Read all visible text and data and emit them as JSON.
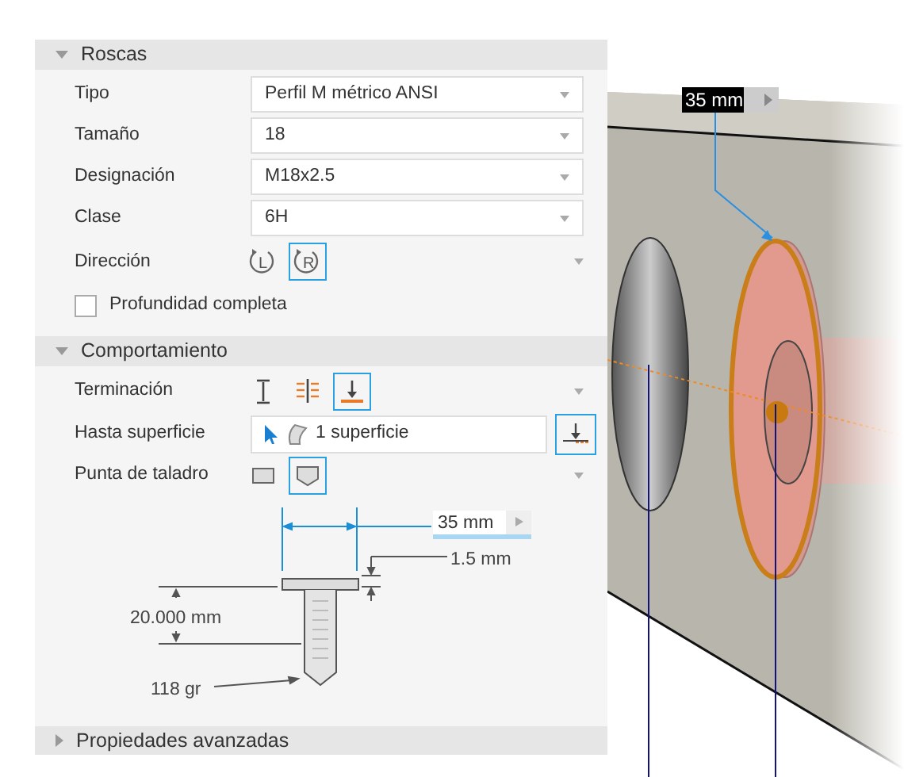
{
  "panel": {
    "sections": [
      {
        "title": "Roscas",
        "expanded": true,
        "rows": [
          {
            "kind": "select",
            "label": "Tipo",
            "value": "Perfil M métrico ANSI"
          },
          {
            "kind": "select",
            "label": "Tamaño",
            "value": "18"
          },
          {
            "kind": "select",
            "label": "Designación",
            "value": "M18x2.5"
          },
          {
            "kind": "select",
            "label": "Clase",
            "value": "6H"
          },
          {
            "kind": "direction",
            "label": "Dirección",
            "options": [
              {
                "text": "L",
                "selected": false
              },
              {
                "text": "R",
                "selected": true
              }
            ]
          },
          {
            "kind": "checkbox",
            "label": "Profundidad completa",
            "checked": false
          }
        ]
      },
      {
        "title": "Comportamiento",
        "expanded": true,
        "rows": [
          {
            "kind": "termination",
            "label": "Terminación",
            "options": [
              {
                "selected": false
              },
              {
                "selected": false
              },
              {
                "selected": true
              }
            ]
          },
          {
            "kind": "surface",
            "label": "Hasta superficie",
            "value": "1 superficie"
          },
          {
            "kind": "drill_point",
            "label": "Punta de taladro",
            "options": [
              {
                "selected": false
              },
              {
                "selected": true
              }
            ]
          },
          {
            "kind": "diagram",
            "distance": "35 mm",
            "head_height": "1.5 mm",
            "thread_length": "20.000 mm",
            "point_angle": "118 gr"
          }
        ]
      },
      {
        "title": "Propiedades avanzadas",
        "expanded": false
      }
    ]
  },
  "viewport": {
    "dimension_label": "35 mm"
  }
}
